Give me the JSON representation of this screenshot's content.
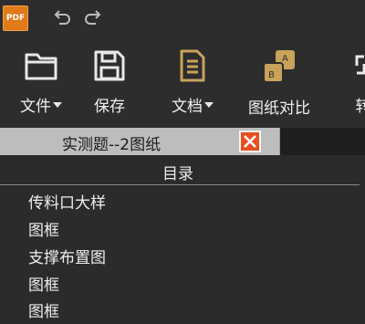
{
  "app": {
    "logo_text": "PDF"
  },
  "toolbar": {
    "items": [
      {
        "label": "文件",
        "icon": "folder-icon",
        "has_dropdown": true
      },
      {
        "label": "保存",
        "icon": "save-icon",
        "has_dropdown": false
      },
      {
        "label": "文档",
        "icon": "document-icon",
        "has_dropdown": true
      },
      {
        "label": "图纸对比",
        "icon": "compare-icon",
        "has_dropdown": false
      },
      {
        "label": "转",
        "icon": "convert-icon",
        "has_dropdown": false
      }
    ]
  },
  "tabs": [
    {
      "label": "实测题--2图纸",
      "active": true
    }
  ],
  "toc": {
    "header": "目录",
    "items": [
      "传料口大样",
      "图框",
      "支撑布置图",
      "图框",
      "图框"
    ]
  },
  "colors": {
    "background": "#2b2b2b",
    "accent_orange": "#e8501e",
    "doc_icon_gold": "#c9a35a"
  }
}
